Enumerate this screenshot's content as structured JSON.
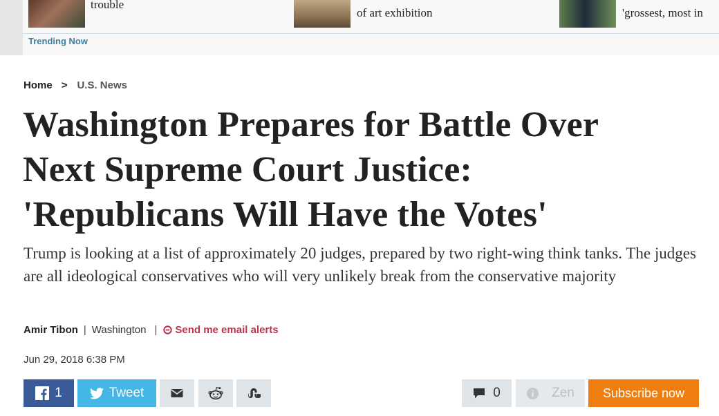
{
  "trending": {
    "label": "Trending Now",
    "items": [
      {
        "title": "trouble",
        "thumb_color": "#7a4e3c",
        "icon": "article-thumbnail"
      },
      {
        "title": "of art exhibition",
        "thumb_color": "#9b8768",
        "icon": "article-thumbnail"
      },
      {
        "title": "'grossest, most in",
        "thumb_color": "#4e6b46",
        "icon": "article-thumbnail"
      }
    ]
  },
  "breadcrumb": {
    "home": "Home",
    "separator": ">",
    "section": "U.S. News"
  },
  "article": {
    "headline_line1": "Washington Prepares for Battle Over",
    "headline_line2": "Next Supreme Court Justice:",
    "headline_line3": "'Republicans Will Have the Votes'",
    "subhead": "Trump is looking at a list of approximately 20 judges, prepared by two right-wing think tanks. The judges are all ideological conservatives who will very unlikely break from the conservative majority",
    "author": "Amir Tibon",
    "location": "Washington",
    "alerts_label": "Send me email alerts",
    "date": "Jun 29, 2018 6:38 PM"
  },
  "share": {
    "facebook_count": "1",
    "tweet_label": "Tweet",
    "comments_count": "0",
    "zen_label": "Zen",
    "subscribe_label": "Subscribe now"
  },
  "colors": {
    "facebook": "#3a5a98",
    "twitter": "#44b6e6",
    "subscribe": "#ef7d10",
    "alerts": "#c0314a",
    "trending_label": "#3e7ea1"
  }
}
